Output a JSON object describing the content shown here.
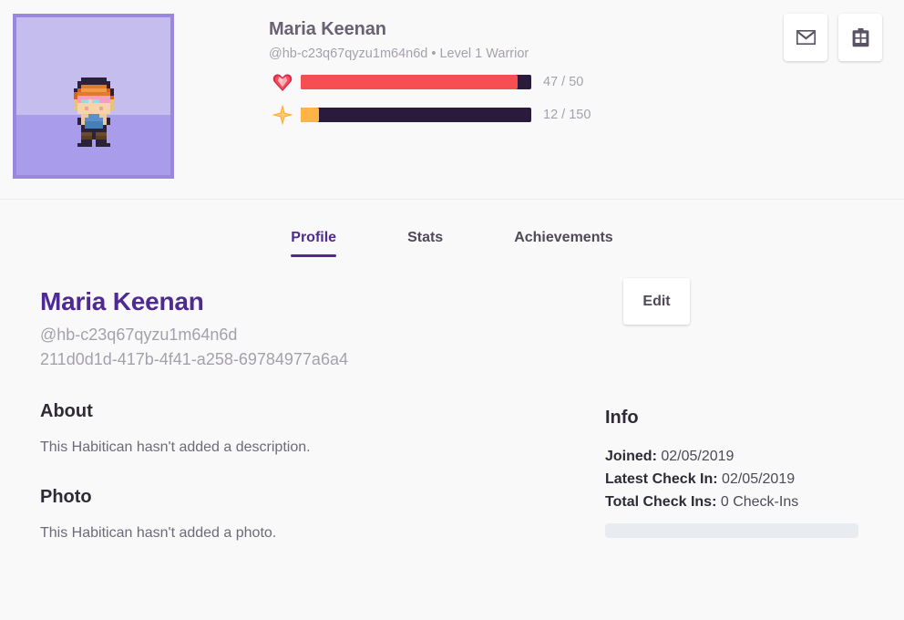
{
  "colors": {
    "accent_purple": "#4F2A93",
    "hp_red": "#F74E52",
    "xp_gold": "#FFB445",
    "bar_track": "#2A1B3D",
    "avatar_sky": "#C5BDEE",
    "avatar_ground": "#A99CEB",
    "avatar_border": "#9B87E0",
    "page_background": "#F9F9F9",
    "placeholder_gray": "#E8EBF0"
  },
  "header": {
    "avatar_name": "pixel-character-avatar",
    "display_name": "Maria Keenan",
    "username": "@hb-c23q67qyzu1m64n6d",
    "separator": "•",
    "level_class": "Level 1 Warrior",
    "subline": "@hb-c23q67qyzu1m64n6d • Level 1 Warrior",
    "bars": [
      {
        "name": "health",
        "icon": "heart-gem-icon",
        "current": 47,
        "max": 50,
        "label": "47 / 50",
        "percent": 94
      },
      {
        "name": "experience",
        "icon": "star-sparkle-icon",
        "current": 12,
        "max": 150,
        "label": "12 / 150",
        "percent": 8
      }
    ],
    "actions": [
      {
        "name": "send-message-button",
        "icon": "envelope-icon"
      },
      {
        "name": "add-to-party-button",
        "icon": "clipboard-grid-icon"
      }
    ]
  },
  "tabs": [
    {
      "label": "Profile",
      "active": true
    },
    {
      "label": "Stats",
      "active": false
    },
    {
      "label": "Achievements",
      "active": false
    }
  ],
  "profile": {
    "name": "Maria Keenan",
    "username": "@hb-c23q67qyzu1m64n6d",
    "user_id": "211d0d1d-417b-4f41-a258-69784977a6a4",
    "edit_label": "Edit",
    "about_heading": "About",
    "about_text": "This Habitican hasn't added a description.",
    "photo_heading": "Photo",
    "photo_text": "This Habitican hasn't added a photo."
  },
  "info": {
    "heading": "Info",
    "rows": [
      {
        "key": "Joined:",
        "value": "02/05/2019"
      },
      {
        "key": "Latest Check In:",
        "value": "02/05/2019"
      },
      {
        "key": "Total Check Ins:",
        "value": "0 Check-Ins"
      }
    ]
  }
}
